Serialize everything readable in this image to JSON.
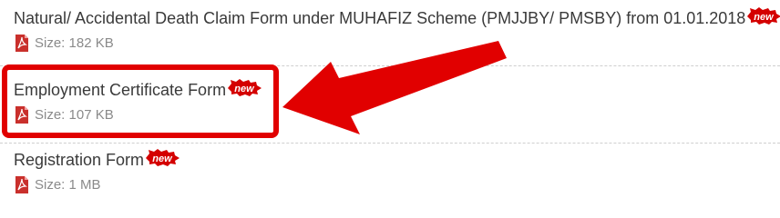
{
  "downloads": [
    {
      "title": "Natural/ Accidental Death Claim Form under MUHAFIZ Scheme (PMJJBY/ PMSBY) from 01.01.2018",
      "badge": "new",
      "size": "Size: 182 KB"
    },
    {
      "title": "Employment Certificate Form",
      "badge": "new",
      "size": "Size: 107 KB"
    },
    {
      "title": "Registration Form",
      "badge": "new",
      "size": "Size: 1 MB"
    }
  ],
  "colors": {
    "highlight": "#e10000",
    "badge": "#d40000",
    "pdf": "#c9302c"
  },
  "icons": {
    "file": "pdf-file-icon",
    "badge": "new-badge-icon",
    "annotation": "red-arrow-icon"
  }
}
